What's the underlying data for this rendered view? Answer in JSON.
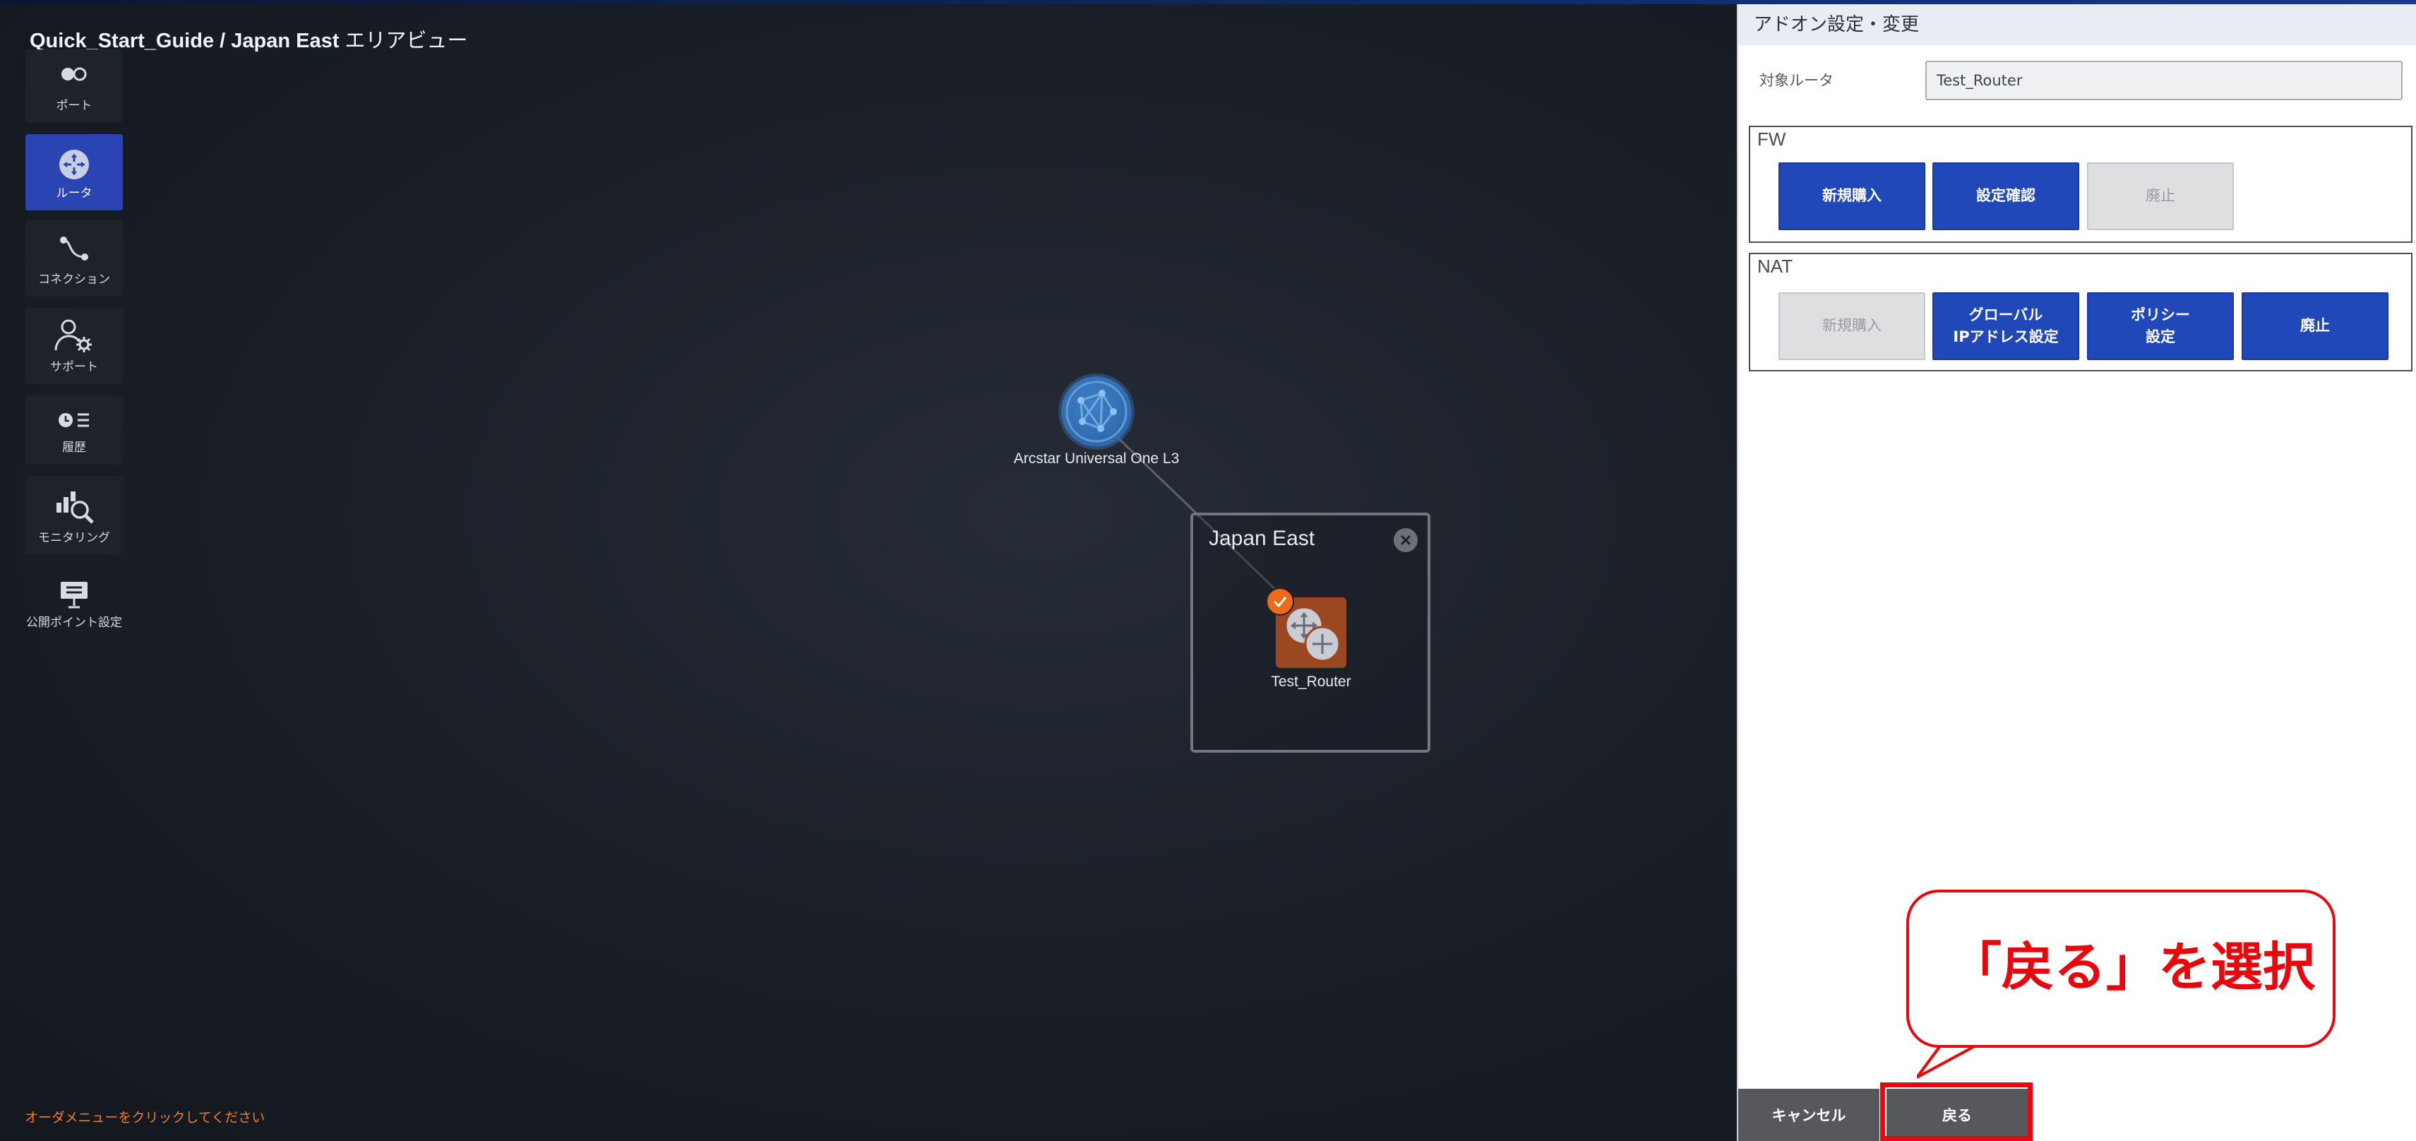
{
  "canvas": {
    "breadcrumb_path": "Quick_Start_Guide / Japan East",
    "breadcrumb_view": "エリアビュー",
    "order_hint": "オーダメニューをクリックしてください"
  },
  "sidebar": {
    "items": [
      {
        "label": "ポート",
        "icon": "port-icon"
      },
      {
        "label": "ルータ",
        "icon": "router-icon",
        "active": true
      },
      {
        "label": "コネクション",
        "icon": "connection-icon"
      },
      {
        "label": "サポート",
        "icon": "support-icon"
      },
      {
        "label": "履歴",
        "icon": "history-icon"
      },
      {
        "label": "モニタリング",
        "icon": "monitoring-icon"
      },
      {
        "label": "公開ポイント設定",
        "icon": "public-point-icon"
      }
    ]
  },
  "topology": {
    "cloud_label": "Arcstar Universal One L3",
    "area_title": "Japan East",
    "router_label": "Test_Router"
  },
  "panel": {
    "header": "アドオン設定・変更",
    "target_label": "対象ルータ",
    "target_value": "Test_Router",
    "fw": {
      "title": "FW",
      "buttons": [
        "新規購入",
        "設定確認",
        "廃止"
      ]
    },
    "nat": {
      "title": "NAT",
      "buttons": [
        "新規購入",
        "グローバル\nIPアドレス設定",
        "ポリシー\n設定",
        "廃止"
      ]
    },
    "footer": {
      "cancel": "キャンセル",
      "back": "戻る"
    }
  },
  "annotation": {
    "callout_text": "「戻る」を選択",
    "color": "#e8070c"
  },
  "colors": {
    "primary_button": "#2148b9",
    "router_node": "#9a4722",
    "check_badge": "#ec6a1a",
    "hint_text": "#ef7d24"
  }
}
